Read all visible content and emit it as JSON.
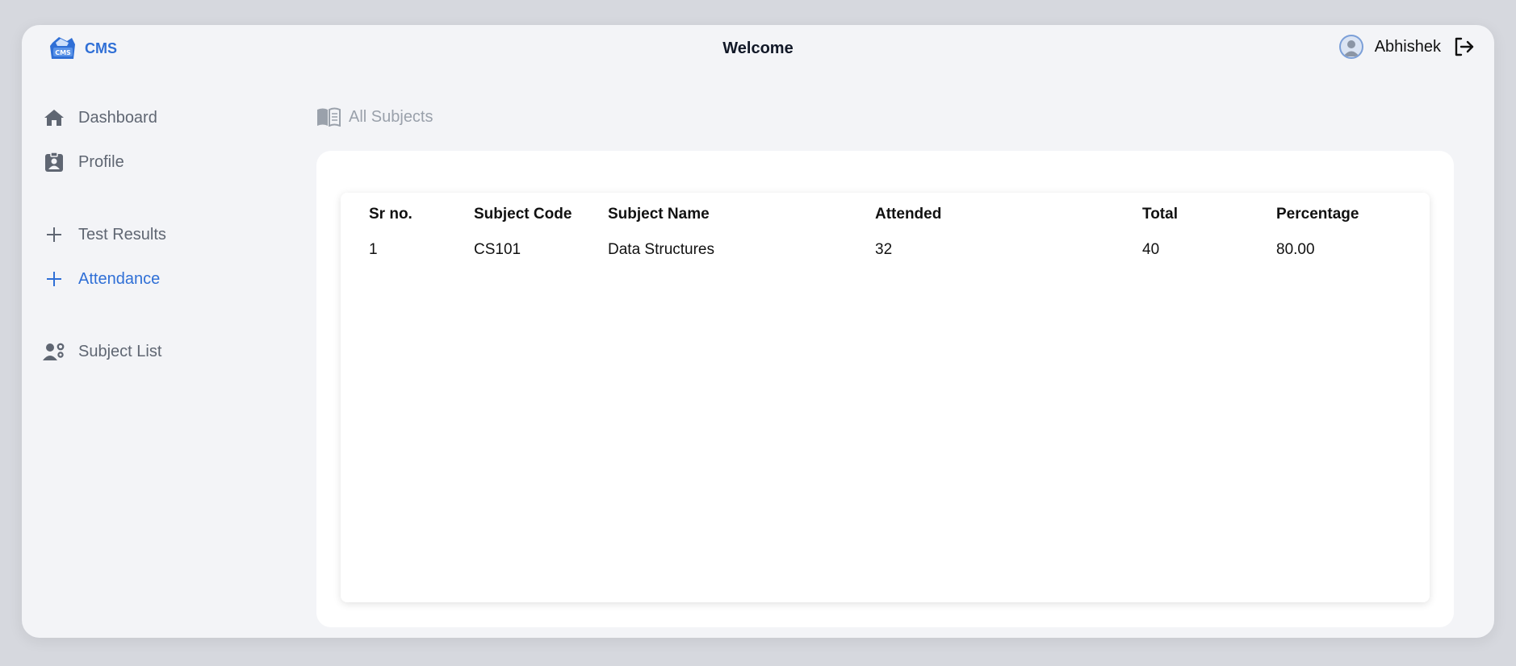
{
  "header": {
    "app_name": "CMS",
    "logo_badge": "CMS",
    "welcome": "Welcome",
    "user_name": "Abhishek"
  },
  "sidebar": {
    "items": [
      {
        "label": "Dashboard",
        "icon": "home-icon"
      },
      {
        "label": "Profile",
        "icon": "id-badge-icon"
      },
      {
        "label": "Test Results",
        "icon": "plus-icon"
      },
      {
        "label": "Attendance",
        "icon": "plus-icon",
        "active": true
      },
      {
        "label": "Subject List",
        "icon": "user-gear-icon"
      }
    ]
  },
  "main": {
    "breadcrumb": "All Subjects",
    "table": {
      "headers": [
        "Sr no.",
        "Subject Code",
        "Subject Name",
        "Attended",
        "Total",
        "Percentage"
      ],
      "rows": [
        [
          "1",
          "CS101",
          "Data Structures",
          "32",
          "40",
          "80.00"
        ]
      ]
    }
  },
  "colors": {
    "accent": "#2f6fd6",
    "background": "#f3f4f7",
    "muted": "#5f6672"
  }
}
